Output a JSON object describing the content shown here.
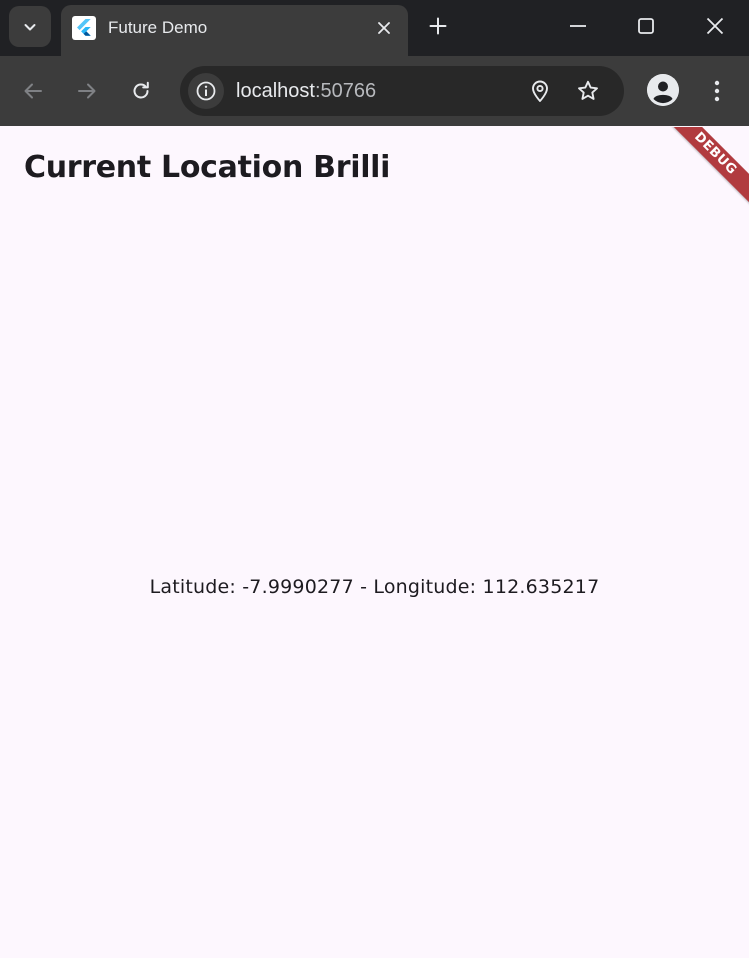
{
  "browser": {
    "tab": {
      "title": "Future Demo",
      "favicon": "flutter-logo-icon"
    },
    "address_bar": {
      "host": "localhost",
      "port": ":50766"
    },
    "icons": {
      "tab_search": "chevron-down-icon",
      "tab_close": "close-icon",
      "new_tab": "plus-icon",
      "minimize": "minimize-icon",
      "maximize": "maximize-icon",
      "close_window": "close-icon",
      "back": "arrow-left-icon",
      "forward": "arrow-right-icon",
      "reload": "reload-icon",
      "site_info": "info-icon",
      "location": "location-pin-icon",
      "bookmark": "star-icon",
      "profile": "person-icon",
      "menu": "kebab-menu-icon"
    }
  },
  "app": {
    "title": "Current Location Brilli",
    "location_text": "Latitude: -7.9990277 - Longitude: 112.635217",
    "debug_banner": "DEBUG"
  },
  "colors": {
    "tabstrip": "#202124",
    "toolbar": "#3c3c3c",
    "page_background": "#fdf7fe",
    "debug_banner": "#b13b3f"
  }
}
